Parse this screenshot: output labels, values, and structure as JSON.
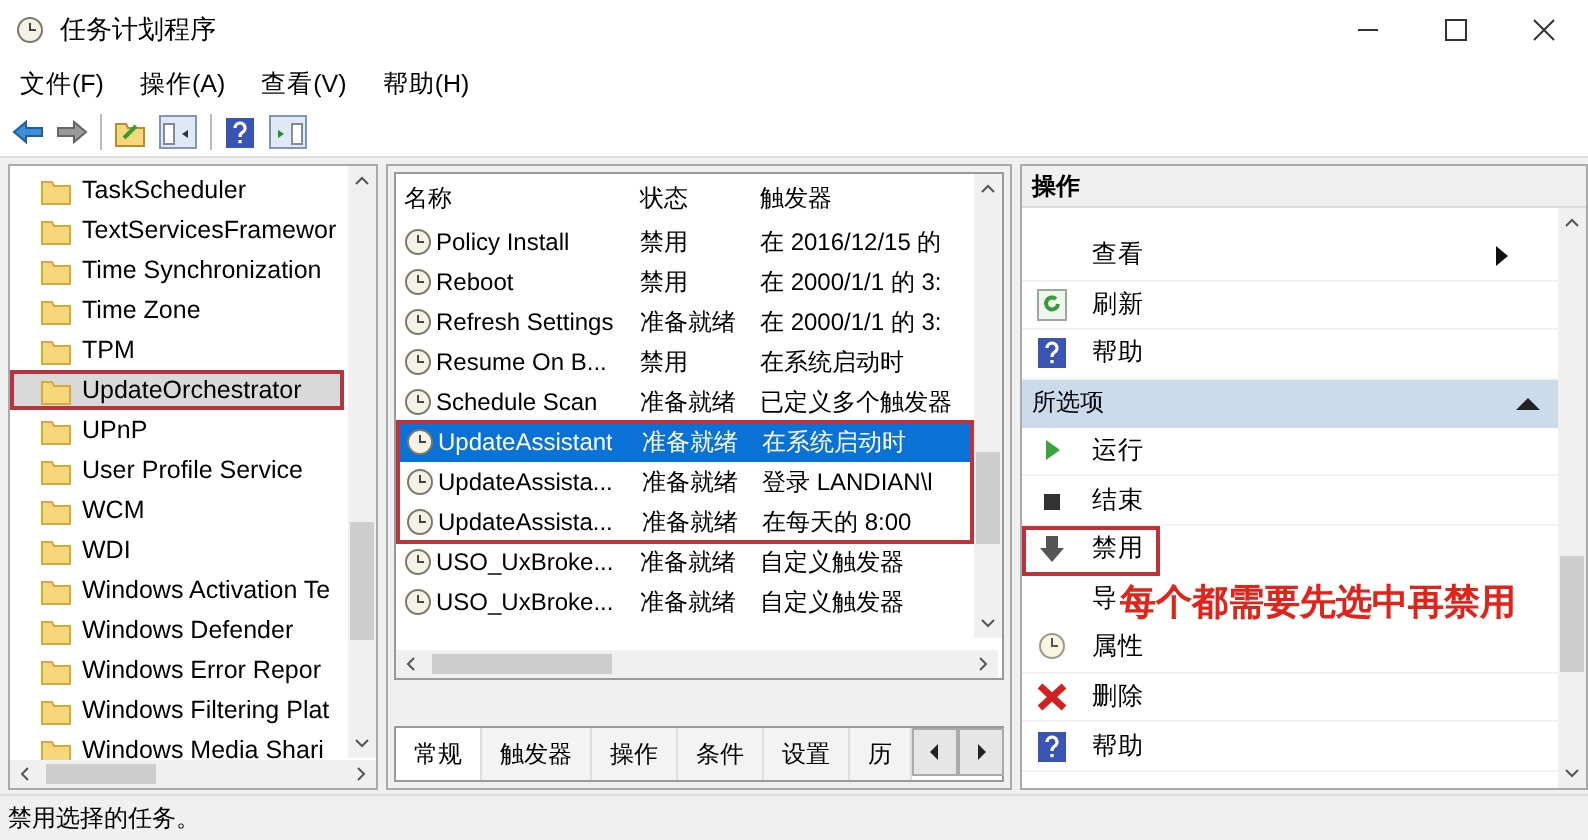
{
  "window": {
    "title": "任务计划程序"
  },
  "menu": [
    "文件(F)",
    "操作(A)",
    "查看(V)",
    "帮助(H)"
  ],
  "tree": {
    "items": [
      {
        "label": "TaskScheduler",
        "selected": false,
        "highlighted": false
      },
      {
        "label": "TextServicesFramewor",
        "selected": false,
        "highlighted": false
      },
      {
        "label": "Time Synchronization",
        "selected": false,
        "highlighted": false
      },
      {
        "label": "Time Zone",
        "selected": false,
        "highlighted": false
      },
      {
        "label": "TPM",
        "selected": false,
        "highlighted": false
      },
      {
        "label": "UpdateOrchestrator",
        "selected": true,
        "highlighted": true
      },
      {
        "label": "UPnP",
        "selected": false,
        "highlighted": false
      },
      {
        "label": "User Profile Service",
        "selected": false,
        "highlighted": false
      },
      {
        "label": "WCM",
        "selected": false,
        "highlighted": false
      },
      {
        "label": "WDI",
        "selected": false,
        "highlighted": false
      },
      {
        "label": "Windows Activation Te",
        "selected": false,
        "highlighted": false
      },
      {
        "label": "Windows Defender",
        "selected": false,
        "highlighted": false
      },
      {
        "label": "Windows Error Repor",
        "selected": false,
        "highlighted": false
      },
      {
        "label": "Windows Filtering Plat",
        "selected": false,
        "highlighted": false
      },
      {
        "label": "Windows Media Shari",
        "selected": false,
        "highlighted": false
      }
    ]
  },
  "tasks": {
    "columns": [
      "名称",
      "状态",
      "触发器"
    ],
    "rows": [
      {
        "name": "Policy Install",
        "status": "禁用",
        "trigger": "在 2016/12/15 的",
        "selected": false,
        "highlighted": false
      },
      {
        "name": "Reboot",
        "status": "禁用",
        "trigger": "在 2000/1/1 的 3:",
        "selected": false,
        "highlighted": false
      },
      {
        "name": "Refresh Settings",
        "status": "准备就绪",
        "trigger": "在 2000/1/1 的 3:",
        "selected": false,
        "highlighted": false
      },
      {
        "name": "Resume On B...",
        "status": "禁用",
        "trigger": "在系统启动时",
        "selected": false,
        "highlighted": false
      },
      {
        "name": "Schedule Scan",
        "status": "准备就绪",
        "trigger": "已定义多个触发器",
        "selected": false,
        "highlighted": false
      },
      {
        "name": "UpdateAssistant",
        "status": "准备就绪",
        "trigger": "在系统启动时",
        "selected": true,
        "highlighted": true
      },
      {
        "name": "UpdateAssista...",
        "status": "准备就绪",
        "trigger": "登录 LANDIAN\\l",
        "selected": false,
        "highlighted": true
      },
      {
        "name": "UpdateAssista...",
        "status": "准备就绪",
        "trigger": "在每天的 8:00",
        "selected": false,
        "highlighted": true
      },
      {
        "name": "USO_UxBroke...",
        "status": "准备就绪",
        "trigger": "自定义触发器",
        "selected": false,
        "highlighted": false
      },
      {
        "name": "USO_UxBroke...",
        "status": "准备就绪",
        "trigger": "自定义触发器",
        "selected": false,
        "highlighted": false
      }
    ],
    "tabs": [
      {
        "label": "常规",
        "selected": true
      },
      {
        "label": "触发器",
        "selected": false
      },
      {
        "label": "操作",
        "selected": false
      },
      {
        "label": "条件",
        "selected": false
      },
      {
        "label": "设置",
        "selected": false
      },
      {
        "label": "历",
        "selected": false
      }
    ]
  },
  "actions": {
    "title": "操作",
    "items": [
      {
        "kind": "submenu",
        "label": "查看",
        "highlighted": false
      },
      {
        "kind": "refresh",
        "label": "刷新",
        "highlighted": false
      },
      {
        "kind": "help",
        "label": "帮助",
        "highlighted": false
      },
      {
        "kind": "section",
        "label": "所选项",
        "expanded": true
      },
      {
        "kind": "run",
        "label": "运行",
        "highlighted": false
      },
      {
        "kind": "end",
        "label": "结束",
        "highlighted": false
      },
      {
        "kind": "disable",
        "label": "禁用",
        "highlighted": true
      },
      {
        "kind": "plain",
        "label": "导",
        "highlighted": false
      },
      {
        "kind": "properties",
        "label": "属性",
        "highlighted": false
      },
      {
        "kind": "delete",
        "label": "删除",
        "highlighted": false
      },
      {
        "kind": "help",
        "label": "帮助",
        "highlighted": false
      }
    ]
  },
  "annotation": {
    "text": "每个都需要先选中再禁用"
  },
  "status_bar": {
    "text": "禁用选择的任务。"
  }
}
